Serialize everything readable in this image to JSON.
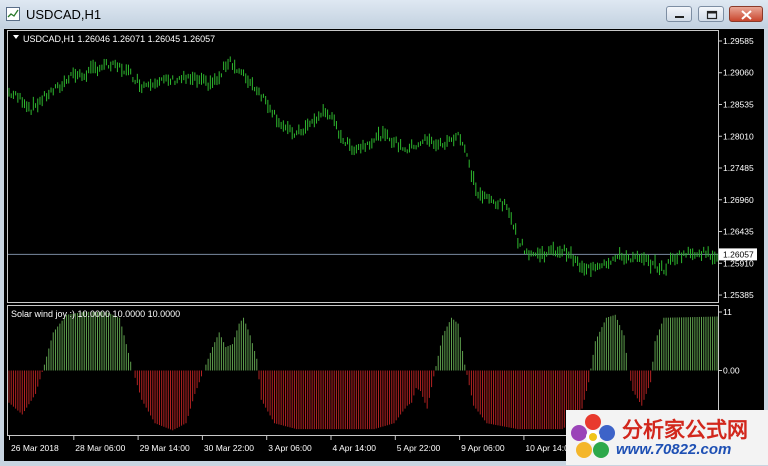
{
  "window": {
    "title": "USDCAD,H1"
  },
  "price_panel": {
    "header": "USDCAD,H1  1.26046 1.26071 1.26045 1.26057",
    "current_price": "1.26057",
    "current_price_value": 1.26057,
    "y_ticks": [
      "1.29585",
      "1.29060",
      "1.28535",
      "1.28010",
      "1.27485",
      "1.26960",
      "1.26435",
      "1.25910",
      "1.25385"
    ],
    "y_tick_values": [
      1.29585,
      1.2906,
      1.28535,
      1.2801,
      1.27485,
      1.2696,
      1.26435,
      1.2591,
      1.25385
    ],
    "bar_color": "#2eb82e",
    "price_line_color": "#7a8aa0"
  },
  "indicator_panel": {
    "label": "Solar wind joy :) 10.0000 10.0000 10.0000",
    "y_ticks": [
      "11",
      "0.00"
    ],
    "positive_color": "#5fa04e",
    "negative_color": "#b22222"
  },
  "x_axis": {
    "labels": [
      "26 Mar 2018",
      "28 Mar 06:00",
      "29 Mar 14:00",
      "30 Mar 22:00",
      "3 Apr 06:00",
      "4 Apr 14:00",
      "5 Apr 22:00",
      "9 Apr 06:00",
      "10 Apr 14:00"
    ]
  },
  "chart_data": [
    {
      "type": "bar",
      "title": "USDCAD,H1",
      "ylim": [
        1.2527,
        1.2975
      ],
      "series": [
        {
          "name": "USDCAD,H1",
          "keypoints": [
            [
              0,
              1.2873
            ],
            [
              6,
              1.2862
            ],
            [
              10,
              1.2846
            ],
            [
              14,
              1.2859
            ],
            [
              18,
              1.2872
            ],
            [
              24,
              1.2885
            ],
            [
              28,
              1.2905
            ],
            [
              33,
              1.29
            ],
            [
              38,
              1.2912
            ],
            [
              44,
              1.2918
            ],
            [
              50,
              1.2915
            ],
            [
              55,
              1.2904
            ],
            [
              60,
              1.2885
            ],
            [
              66,
              1.2893
            ],
            [
              72,
              1.2892
            ],
            [
              78,
              1.2897
            ],
            [
              84,
              1.2894
            ],
            [
              90,
              1.2888
            ],
            [
              95,
              1.2895
            ],
            [
              98,
              1.292
            ],
            [
              100,
              1.2928
            ],
            [
              103,
              1.291
            ],
            [
              108,
              1.2895
            ],
            [
              113,
              1.2875
            ],
            [
              118,
              1.285
            ],
            [
              122,
              1.2826
            ],
            [
              126,
              1.281
            ],
            [
              130,
              1.2804
            ],
            [
              134,
              1.2815
            ],
            [
              138,
              1.2826
            ],
            [
              142,
              1.2841
            ],
            [
              145,
              1.2837
            ],
            [
              148,
              1.2815
            ],
            [
              152,
              1.279
            ],
            [
              156,
              1.2781
            ],
            [
              160,
              1.2785
            ],
            [
              164,
              1.2794
            ],
            [
              168,
              1.2803
            ],
            [
              172,
              1.2798
            ],
            [
              176,
              1.2787
            ],
            [
              180,
              1.2779
            ],
            [
              184,
              1.2787
            ],
            [
              188,
              1.2795
            ],
            [
              192,
              1.279
            ],
            [
              196,
              1.2786
            ],
            [
              200,
              1.2796
            ],
            [
              203,
              1.2806
            ],
            [
              206,
              1.278
            ],
            [
              209,
              1.274
            ],
            [
              212,
              1.2705
            ],
            [
              216,
              1.2698
            ],
            [
              220,
              1.2692
            ],
            [
              224,
              1.2687
            ],
            [
              227,
              1.267
            ],
            [
              230,
              1.263
            ],
            [
              234,
              1.261
            ],
            [
              238,
              1.2605
            ],
            [
              243,
              1.2608
            ],
            [
              248,
              1.2612
            ],
            [
              252,
              1.2611
            ],
            [
              256,
              1.2595
            ],
            [
              260,
              1.2578
            ],
            [
              264,
              1.2587
            ],
            [
              268,
              1.2591
            ],
            [
              272,
              1.2596
            ],
            [
              276,
              1.2602
            ],
            [
              280,
              1.2601
            ],
            [
              284,
              1.2598
            ],
            [
              288,
              1.2595
            ],
            [
              292,
              1.2588
            ],
            [
              296,
              1.258
            ],
            [
              300,
              1.26
            ],
            [
              304,
              1.2606
            ],
            [
              308,
              1.2607
            ],
            [
              312,
              1.261
            ],
            [
              316,
              1.2606
            ],
            [
              320,
              1.2605
            ]
          ]
        }
      ]
    },
    {
      "type": "bar",
      "title": "Solar wind joy :) 10.0000 10.0000 10.0000",
      "ylim": [
        -11,
        11
      ],
      "series": [
        {
          "name": "Solar wind joy :)",
          "keypoints": [
            [
              0,
              -5.5
            ],
            [
              6,
              -7.5
            ],
            [
              12,
              -4
            ],
            [
              16,
              1
            ],
            [
              20,
              6.5
            ],
            [
              26,
              9.5
            ],
            [
              34,
              10
            ],
            [
              44,
              10
            ],
            [
              50,
              9
            ],
            [
              56,
              0
            ],
            [
              60,
              -5
            ],
            [
              66,
              -9
            ],
            [
              74,
              -10.2
            ],
            [
              80,
              -9
            ],
            [
              84,
              -4
            ],
            [
              88,
              0
            ],
            [
              92,
              4
            ],
            [
              95,
              6.5
            ],
            [
              98,
              4
            ],
            [
              101,
              4.5
            ],
            [
              104,
              8
            ],
            [
              106,
              9
            ],
            [
              109,
              6
            ],
            [
              112,
              2
            ],
            [
              114,
              -5
            ],
            [
              120,
              -9
            ],
            [
              130,
              -10
            ],
            [
              150,
              -10
            ],
            [
              165,
              -10
            ],
            [
              174,
              -9
            ],
            [
              180,
              -6
            ],
            [
              182,
              -5.5
            ],
            [
              184,
              -3
            ],
            [
              186,
              -3.5
            ],
            [
              189,
              -6.5
            ],
            [
              192,
              -1
            ],
            [
              196,
              6
            ],
            [
              200,
              9
            ],
            [
              203,
              8
            ],
            [
              206,
              1
            ],
            [
              210,
              -6
            ],
            [
              216,
              -9
            ],
            [
              230,
              -10
            ],
            [
              250,
              -10
            ],
            [
              258,
              -8
            ],
            [
              262,
              -2
            ],
            [
              265,
              5
            ],
            [
              270,
              9
            ],
            [
              274,
              9.5
            ],
            [
              278,
              6
            ],
            [
              280,
              0
            ],
            [
              282,
              -3.5
            ],
            [
              286,
              -6
            ],
            [
              290,
              -2
            ],
            [
              292,
              5
            ],
            [
              296,
              9
            ],
            [
              320,
              9.2
            ]
          ]
        }
      ]
    }
  ]
}
